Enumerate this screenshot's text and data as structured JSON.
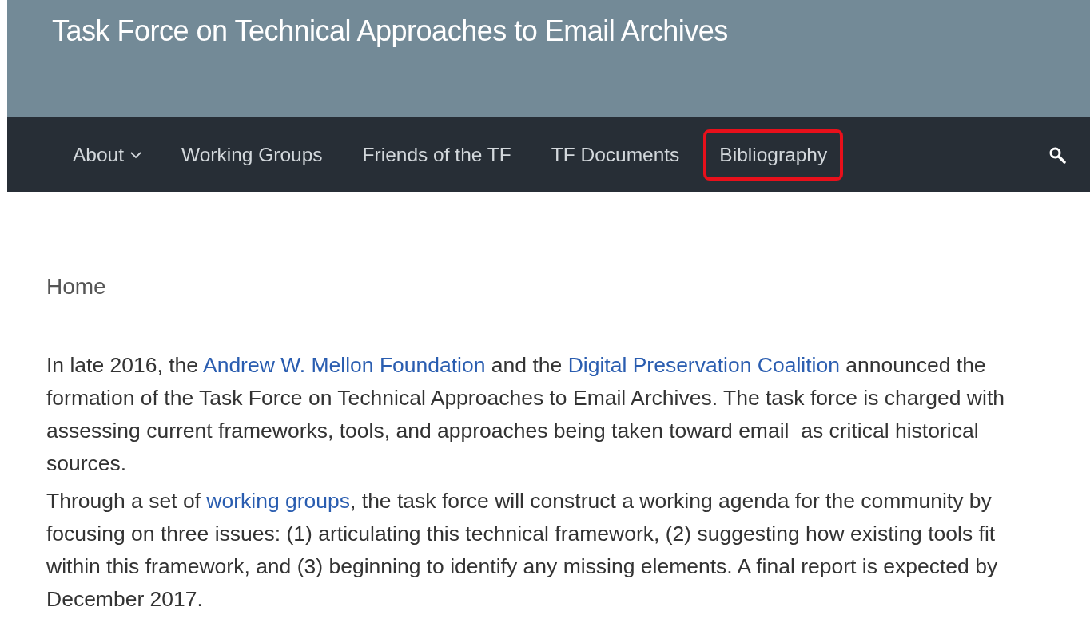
{
  "header": {
    "title": "Task Force on Technical Approaches to Email Archives"
  },
  "nav": {
    "items": [
      {
        "label": "About",
        "dropdown": true,
        "highlighted": false
      },
      {
        "label": "Working Groups",
        "dropdown": false,
        "highlighted": false
      },
      {
        "label": "Friends of the TF",
        "dropdown": false,
        "highlighted": false
      },
      {
        "label": "TF Documents",
        "dropdown": false,
        "highlighted": false
      },
      {
        "label": "Bibliography",
        "dropdown": false,
        "highlighted": true
      }
    ],
    "search": true
  },
  "content": {
    "heading": "Home",
    "paragraphs": [
      [
        {
          "kind": "text",
          "text": "In late 2016, the "
        },
        {
          "kind": "link",
          "text": "Andrew W. Mellon Foundation"
        },
        {
          "kind": "text",
          "text": " and the "
        },
        {
          "kind": "link",
          "text": "Digital Preservation Coalition"
        },
        {
          "kind": "text",
          "text": " announced the formation of the Task Force on Technical Approaches to Email Archives. The task force is charged with assessing current frameworks, tools, and approaches being taken toward email  as critical historical sources."
        }
      ],
      [
        {
          "kind": "text",
          "text": "Through a set of "
        },
        {
          "kind": "link",
          "text": "working groups"
        },
        {
          "kind": "text",
          "text": ", the task force will construct a working agenda for the community by focusing on three issues: (1) articulating this technical framework, (2) suggesting how existing tools fit within this framework, and (3) beginning to identify any missing elements. A final report is expected by December 2017."
        }
      ]
    ]
  }
}
